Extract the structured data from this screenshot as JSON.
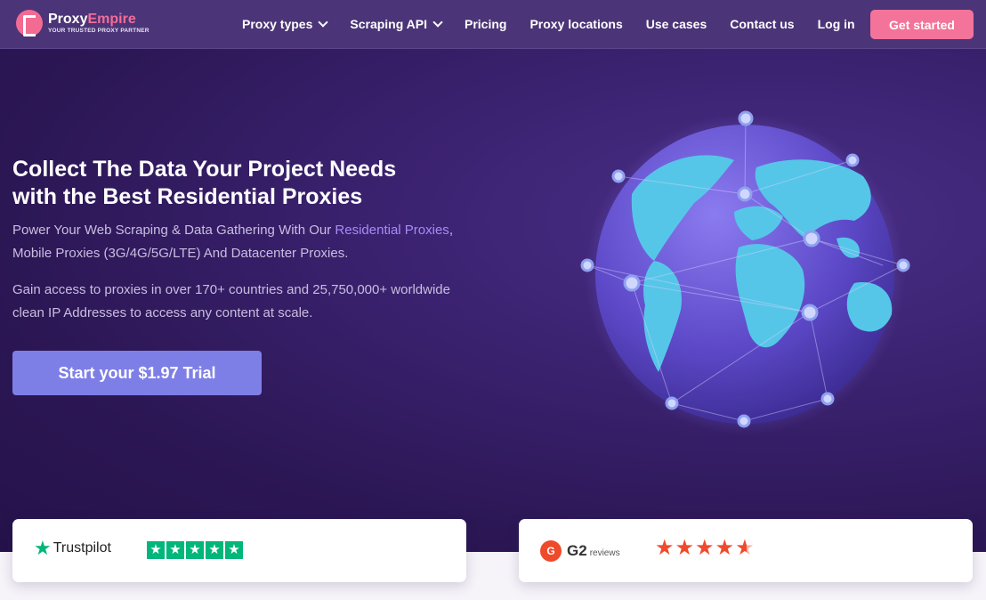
{
  "brand": {
    "name_part1": "Proxy",
    "name_part2": "Empire",
    "tagline": "YOUR TRUSTED PROXY PARTNER",
    "accent_color": "#f4739a"
  },
  "nav": {
    "items": [
      {
        "label": "Proxy types",
        "dropdown": true
      },
      {
        "label": "Scraping API",
        "dropdown": true
      },
      {
        "label": "Pricing",
        "dropdown": false
      },
      {
        "label": "Proxy locations",
        "dropdown": false
      },
      {
        "label": "Use cases",
        "dropdown": false
      },
      {
        "label": "Contact us",
        "dropdown": false
      },
      {
        "label": "Log in",
        "dropdown": false
      }
    ],
    "cta_label": "Get started"
  },
  "hero": {
    "headline_line1": "Collect The Data Your Project Needs",
    "headline_line2": "with the Best Residential Proxies",
    "sub1_before": "Power Your Web Scraping & Data Gathering With Our ",
    "sub1_link": "Residential Proxies",
    "sub1_after": ", Mobile Proxies (3G/4G/5G/LTE) And Datacenter Proxies.",
    "sub2": "Gain access to proxies in over 170+ countries and 25,750,000+ worldwide clean IP Addresses to access any content at scale.",
    "trial_button": "Start your $1.97 Trial",
    "button_color": "#7e7fe6"
  },
  "ratings": {
    "trustpilot": {
      "name": "Trustpilot",
      "stars": 5,
      "color": "#00b67a"
    },
    "g2": {
      "name": "G2",
      "suffix": "reviews",
      "stars": 4.5,
      "color": "#ef4a2b"
    }
  }
}
